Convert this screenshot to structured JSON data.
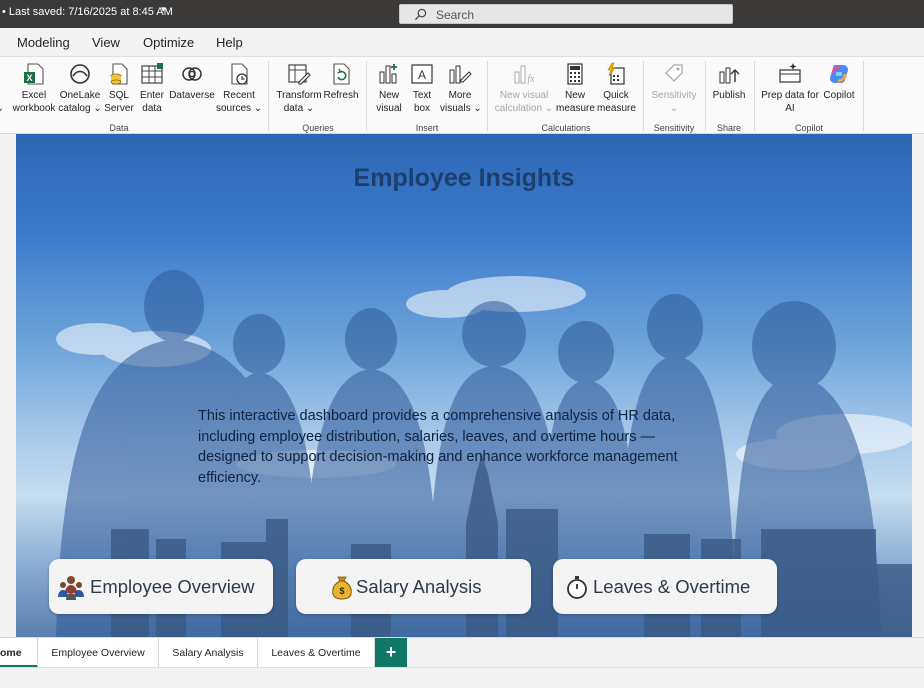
{
  "titlebar": {
    "saved_text": "• Last saved: 7/16/2025 at 8:45 AM",
    "saved_caret": "▾",
    "search_placeholder": "Search"
  },
  "menu": {
    "tabs": [
      "Modeling",
      "View",
      "Optimize",
      "Help"
    ]
  },
  "ribbon": {
    "data": {
      "group_label": "Data",
      "excel": [
        "Excel",
        "workbook"
      ],
      "onelake": [
        "OneLake",
        "catalog ⌄"
      ],
      "sql": [
        "SQL",
        "Server"
      ],
      "enter": [
        "Enter",
        "data"
      ],
      "dataverse": "Dataverse",
      "recent": [
        "Recent",
        "sources ⌄"
      ],
      "partial_caret": "⌄"
    },
    "queries": {
      "group_label": "Queries",
      "transform": [
        "Transform",
        "data ⌄"
      ],
      "refresh": "Refresh"
    },
    "insert": {
      "group_label": "Insert",
      "new_visual": [
        "New",
        "visual"
      ],
      "text_box": [
        "Text",
        "box"
      ],
      "more_visuals": [
        "More",
        "visuals ⌄"
      ]
    },
    "calculations": {
      "group_label": "Calculations",
      "new_visual_calc": [
        "New visual",
        "calculation ⌄"
      ],
      "new_measure": [
        "New",
        "measure"
      ],
      "quick_measure": [
        "Quick",
        "measure"
      ]
    },
    "sensitivity": {
      "group_label": "Sensitivity",
      "sensitivity": [
        "Sensitivity",
        "⌄"
      ]
    },
    "share": {
      "group_label": "Share",
      "publish": "Publish"
    },
    "copilot": {
      "group_label": "Copilot",
      "prep": [
        "Prep data for",
        "AI"
      ],
      "copilot": "Copilot"
    }
  },
  "canvas": {
    "title": "Employee Insights",
    "description": "This interactive dashboard provides a comprehensive analysis of HR data, including employee distribution, salaries, leaves, and overtime hours — designed to support decision-making and enhance workforce management efficiency.",
    "buttons": {
      "employee_overview": "Employee Overview",
      "salary_analysis": "Salary Analysis",
      "leaves_overtime": "Leaves & Overtime"
    }
  },
  "page_tabs": {
    "home": "ome",
    "employee_overview": "Employee Overview",
    "salary_analysis": "Salary Analysis",
    "leaves_overtime": "Leaves & Overtime",
    "add": "+"
  },
  "colors": {
    "accent": "#117865",
    "titlebar": "#3b3a39",
    "title_text": "#1c3f6e"
  }
}
